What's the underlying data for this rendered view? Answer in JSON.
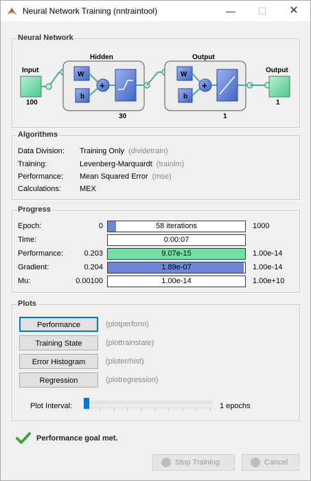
{
  "window": {
    "title": "Neural Network Training (nntraintool)",
    "minimize_glyph": "—",
    "maximize_glyph": "☐",
    "close_glyph": "✕"
  },
  "network": {
    "title": "Neural Network",
    "input_label": "Input",
    "input_size": "100",
    "hidden_label": "Hidden",
    "hidden_size": "30",
    "output_layer_label": "Output",
    "output_layer_size": "1",
    "output_label": "Output",
    "output_size": "1",
    "weight_label": "W",
    "bias_label": "b",
    "sum_glyph": "+",
    "colors": {
      "node": "#7fd9a8",
      "block": "#5b83d9",
      "wire": "#4aa89a"
    }
  },
  "algorithms": {
    "title": "Algorithms",
    "rows": [
      {
        "label": "Data Division:",
        "value": "Training Only",
        "fn": "(dividetrain)"
      },
      {
        "label": "Training:",
        "value": "Levenberg-Marquardt",
        "fn": "(trainlm)"
      },
      {
        "label": "Performance:",
        "value": "Mean Squared Error",
        "fn": "(mse)"
      },
      {
        "label": "Calculations:",
        "value": "MEX",
        "fn": ""
      }
    ]
  },
  "progress": {
    "title": "Progress",
    "rows": [
      {
        "label": "Epoch:",
        "start": "0",
        "bar_text": "58 iterations",
        "end": "1000",
        "fill": 0.058,
        "fill_color": "#6f86d6"
      },
      {
        "label": "Time:",
        "start": "",
        "bar_text": "0:00:07",
        "end": "",
        "fill": 0,
        "fill_color": "#6f86d6"
      },
      {
        "label": "Performance:",
        "start": "0.203",
        "bar_text": "9.07e-15",
        "end": "1.00e-14",
        "fill": 1.0,
        "fill_color": "#72e0a6"
      },
      {
        "label": "Gradient:",
        "start": "0.204",
        "bar_text": "1.89e-07",
        "end": "1.00e-14",
        "fill": 0.99,
        "fill_color": "#6f86d6"
      },
      {
        "label": "Mu:",
        "start": "0.00100",
        "bar_text": "1.00e-14",
        "end": "1.00e+10",
        "fill": 0,
        "fill_color": "#6f86d6"
      }
    ]
  },
  "plots": {
    "title": "Plots",
    "buttons": [
      {
        "label": "Performance",
        "fn": "(plotperform)"
      },
      {
        "label": "Training State",
        "fn": "(plottrainstate)"
      },
      {
        "label": "Error Histogram",
        "fn": "(ploterrhist)"
      },
      {
        "label": "Regression",
        "fn": "(plotregression)"
      }
    ],
    "interval_label": "Plot Interval:",
    "interval_value": "1 epochs",
    "slider_level": 0.0
  },
  "status": {
    "message": "Performance goal met.",
    "color": "#3aa83a"
  },
  "footer": {
    "stop_label": "Stop Training",
    "cancel_label": "Cancel"
  }
}
